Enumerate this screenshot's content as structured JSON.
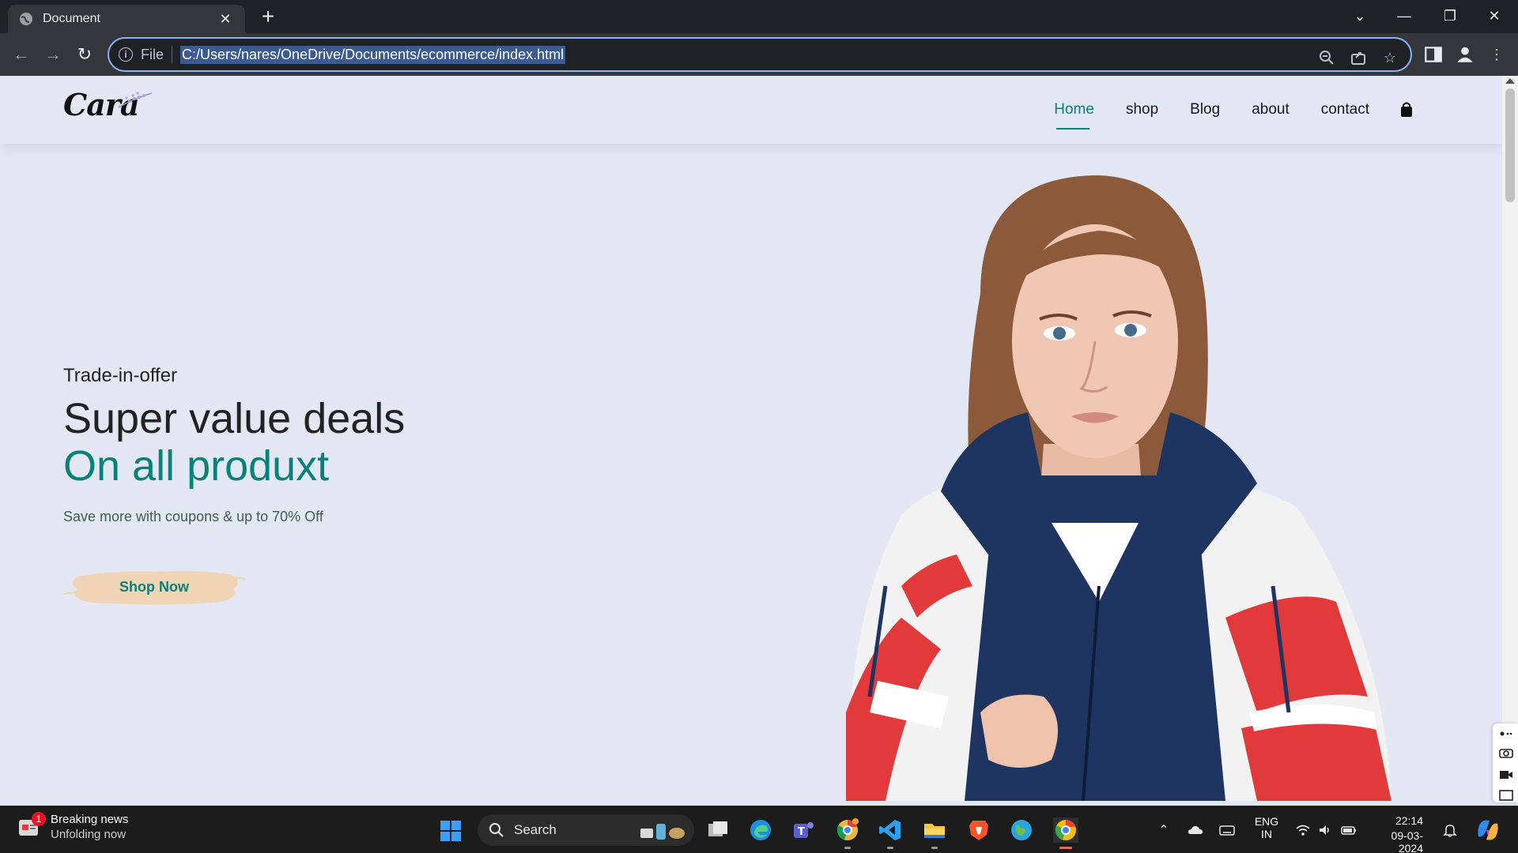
{
  "browser": {
    "tab_title": "Document",
    "omnibox_scheme": "File",
    "url": "C:/Users/nares/OneDrive/Documents/ecommerce/index.html"
  },
  "site": {
    "logo_text": "Cara",
    "nav": [
      {
        "label": "Home",
        "active": true
      },
      {
        "label": "shop"
      },
      {
        "label": "Blog"
      },
      {
        "label": "about"
      },
      {
        "label": "contact"
      }
    ],
    "colors": {
      "accent": "#088178",
      "background": "#e3e6f3",
      "button_bg": "#f0d4b5"
    },
    "hero": {
      "kicker": "Trade-in-offer",
      "headline": "Super value deals",
      "headline_accent": "On all produxt",
      "subtext": "Save more with coupons & up to 70% Off",
      "button_label": "Shop Now"
    }
  },
  "taskbar": {
    "news_title": "Breaking news",
    "news_sub": "Unfolding now",
    "news_badge": "1",
    "search_label": "Search",
    "lang_line1": "ENG",
    "lang_line2": "IN",
    "time": "22:14",
    "date": "09-03-2024"
  }
}
